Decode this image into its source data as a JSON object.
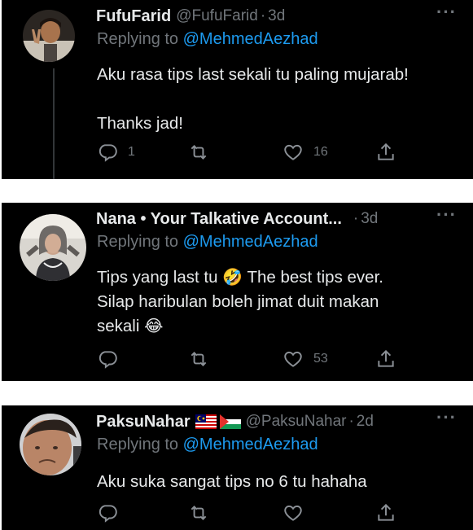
{
  "tweets": [
    {
      "name": "FufuFarid",
      "handle": "@FufuFarid",
      "separator": "·",
      "time": "3d",
      "replying_prefix": "Replying to",
      "replying_handle": "@MehmedAezhad",
      "body_line1": "Aku rasa tips last sekali tu paling mujarab!",
      "body_line2": "Thanks jad!",
      "reply_count": "1",
      "like_count": "16"
    },
    {
      "name": "Nana • Your Talkative Account...",
      "separator": "·",
      "time": "3d",
      "replying_prefix": "Replying to",
      "replying_handle": "@MehmedAezhad",
      "body_line1_a": "Tips yang last tu",
      "emoji_1": "🤣",
      "body_line1_b": "The best tips ever.",
      "body_line2": "Silap haribulan boleh jimat duit makan",
      "body_line3": "sekali",
      "emoji_2": "😂",
      "like_count": "53"
    },
    {
      "name": "PaksuNahar",
      "handle": "@PaksuNahar",
      "separator": "·",
      "time": "2d",
      "replying_prefix": "Replying to",
      "replying_handle": "@MehmedAezhad",
      "body_line1": "Aku suka sangat tips no 6 tu hahaha"
    }
  ],
  "more_label": "···",
  "colors": {
    "background": "#000000",
    "text": "#e7e9ea",
    "muted": "#71767b",
    "link": "#1d9bf0"
  }
}
